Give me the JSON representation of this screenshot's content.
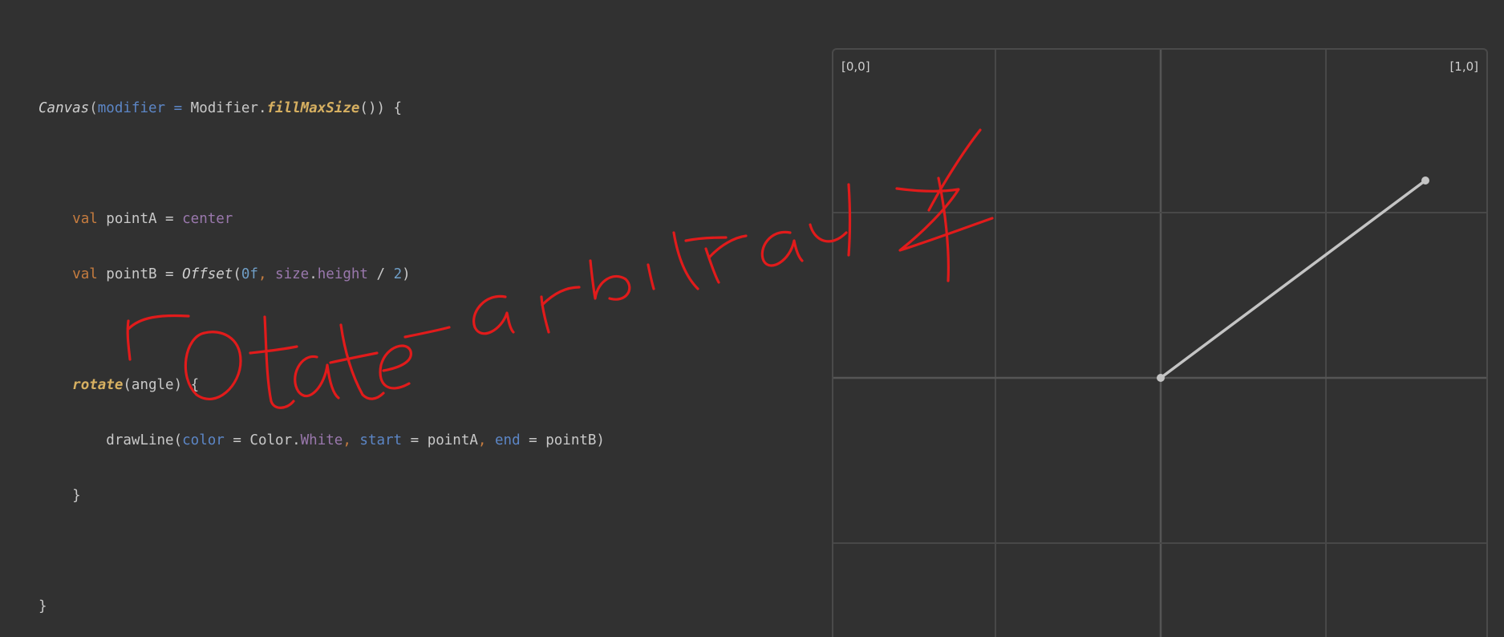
{
  "code": {
    "l1_canvas": "Canvas",
    "l1_paren_open": "(",
    "l1_modifier": "modifier",
    "l1_eq": " = ",
    "l1_modifier_obj": "Modifier.",
    "l1_fill": "fillMaxSize",
    "l1_tail": "()) {",
    "l2_val": "val",
    "l2_name": " pointA = ",
    "l2_center": "center",
    "l3_val": "val",
    "l3_name": " pointB = ",
    "l3_offset": "Offset",
    "l3_open": "(",
    "l3_zero": "0f",
    "l3_comma": ", ",
    "l3_size": "size",
    "l3_dot": ".",
    "l3_height": "height",
    "l3_div": " / ",
    "l3_two": "2",
    "l3_close": ")",
    "l4_rotate": "rotate",
    "l4_tail": "(angle) {",
    "l5_draw": "drawLine(",
    "l5_color": "color",
    "l5_eq1": " = Color.",
    "l5_white": "White",
    "l5_c1": ", ",
    "l5_start": "start",
    "l5_eq2": " = pointA",
    "l5_c2": ", ",
    "l5_end": "end",
    "l5_eq3": " = pointB)",
    "l6_brace": "}",
    "l7_brace": "}"
  },
  "graph": {
    "label_top_left": "[0,0]",
    "label_top_right": "[1,0]",
    "line_color": "#c4c4c4",
    "grid_color": "#4a4a4a"
  },
  "annotation": {
    "handwritten_text": "rotate-arbitrary ∡",
    "ink_color": "#e11b1b"
  }
}
